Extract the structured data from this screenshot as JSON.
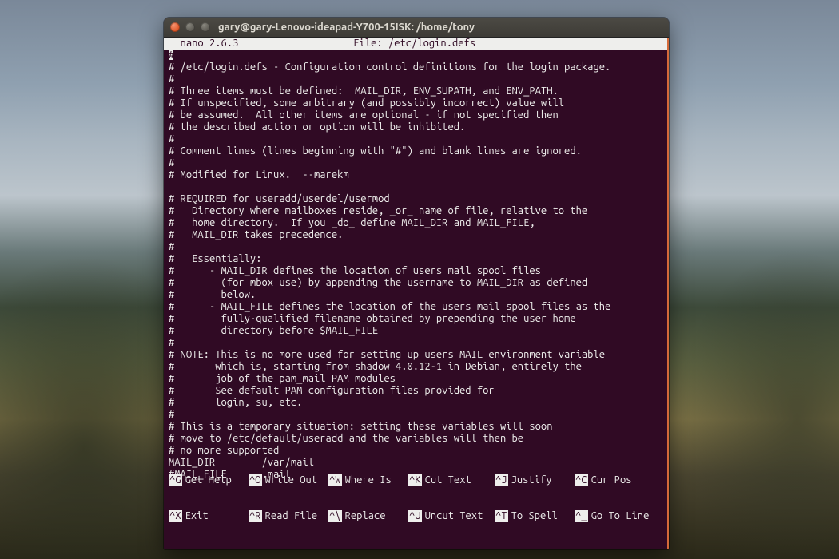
{
  "window": {
    "title": "gary@gary-Lenovo-ideapad-Y700-15ISK: /home/tony"
  },
  "nano": {
    "version": "  nano 2.6.3",
    "file_label": "File: /etc/login.defs",
    "lines": [
      "#",
      "# /etc/login.defs - Configuration control definitions for the login package.",
      "#",
      "# Three items must be defined:  MAIL_DIR, ENV_SUPATH, and ENV_PATH.",
      "# If unspecified, some arbitrary (and possibly incorrect) value will",
      "# be assumed.  All other items are optional - if not specified then",
      "# the described action or option will be inhibited.",
      "#",
      "# Comment lines (lines beginning with \"#\") and blank lines are ignored.",
      "#",
      "# Modified for Linux.  --marekm",
      "",
      "# REQUIRED for useradd/userdel/usermod",
      "#   Directory where mailboxes reside, _or_ name of file, relative to the",
      "#   home directory.  If you _do_ define MAIL_DIR and MAIL_FILE,",
      "#   MAIL_DIR takes precedence.",
      "#",
      "#   Essentially:",
      "#      - MAIL_DIR defines the location of users mail spool files",
      "#        (for mbox use) by appending the username to MAIL_DIR as defined",
      "#        below.",
      "#      - MAIL_FILE defines the location of the users mail spool files as the",
      "#        fully-qualified filename obtained by prepending the user home",
      "#        directory before $MAIL_FILE",
      "#",
      "# NOTE: This is no more used for setting up users MAIL environment variable",
      "#       which is, starting from shadow 4.0.12-1 in Debian, entirely the",
      "#       job of the pam_mail PAM modules",
      "#       See default PAM configuration files provided for",
      "#       login, su, etc.",
      "#",
      "# This is a temporary situation: setting these variables will soon",
      "# move to /etc/default/useradd and the variables will then be",
      "# no more supported",
      "MAIL_DIR        /var/mail",
      "#MAIL_FILE      .mail"
    ]
  },
  "shortcuts": {
    "row1": [
      {
        "key": "^G",
        "label": "Get Help"
      },
      {
        "key": "^O",
        "label": "Write Out"
      },
      {
        "key": "^W",
        "label": "Where Is"
      },
      {
        "key": "^K",
        "label": "Cut Text"
      },
      {
        "key": "^J",
        "label": "Justify"
      },
      {
        "key": "^C",
        "label": "Cur Pos"
      }
    ],
    "row2": [
      {
        "key": "^X",
        "label": "Exit"
      },
      {
        "key": "^R",
        "label": "Read File"
      },
      {
        "key": "^\\",
        "label": "Replace"
      },
      {
        "key": "^U",
        "label": "Uncut Text"
      },
      {
        "key": "^T",
        "label": "To Spell"
      },
      {
        "key": "^_",
        "label": "Go To Line"
      }
    ]
  }
}
